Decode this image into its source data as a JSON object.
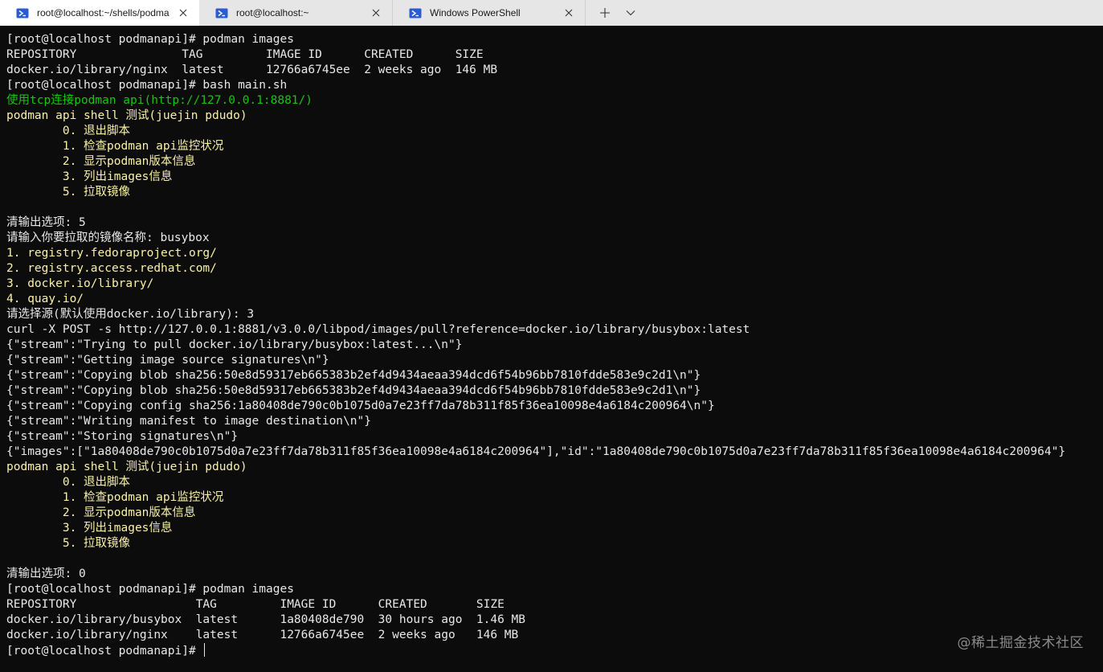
{
  "tabs": [
    {
      "label": "root@localhost:~/shells/podma",
      "icon": "powershell-icon",
      "active": true
    },
    {
      "label": "root@localhost:~",
      "icon": "powershell-icon",
      "active": false
    },
    {
      "label": "Windows PowerShell",
      "icon": "powershell-icon",
      "active": false
    }
  ],
  "tabbar": {
    "new_tab_icon": "plus-icon",
    "dropdown_icon": "chevron-down-icon"
  },
  "colors": {
    "background": "#0c0c0c",
    "foreground": "#e8e8e8",
    "yellow": "#f9f1a5",
    "green": "#16c60c",
    "tabbar": "#e6e6e6",
    "active_tab": "#ffffff",
    "tab_icon": "#2a5bd7"
  },
  "terminal": {
    "lines": [
      {
        "text": "[root@localhost podmanapi]# podman images",
        "color": "white"
      },
      {
        "text": "REPOSITORY               TAG         IMAGE ID      CREATED      SIZE",
        "color": "white"
      },
      {
        "text": "docker.io/library/nginx  latest      12766a6745ee  2 weeks ago  146 MB",
        "color": "white"
      },
      {
        "text": "[root@localhost podmanapi]# bash main.sh",
        "color": "white"
      },
      {
        "text": "使用tcp连接podman api(http://127.0.0.1:8881/)",
        "color": "green"
      },
      {
        "text": "podman api shell 测试(juejin pdudo)",
        "color": "yellow"
      },
      {
        "text": "        0. 退出脚本",
        "color": "yellow"
      },
      {
        "text": "        1. 检查podman api监控状况",
        "color": "yellow"
      },
      {
        "text": "        2. 显示podman版本信息",
        "color": "yellow"
      },
      {
        "text": "        3. 列出images信息",
        "color": "yellow"
      },
      {
        "text": "        5. 拉取镜像",
        "color": "yellow"
      },
      {
        "text": "",
        "color": "white"
      },
      {
        "text": "清输出选项: 5",
        "color": "white"
      },
      {
        "text": "请输入你要拉取的镜像名称: busybox",
        "color": "white"
      },
      {
        "text": "1. registry.fedoraproject.org/",
        "color": "yellow"
      },
      {
        "text": "2. registry.access.redhat.com/",
        "color": "yellow"
      },
      {
        "text": "3. docker.io/library/",
        "color": "yellow"
      },
      {
        "text": "4. quay.io/",
        "color": "yellow"
      },
      {
        "text": "请选择源(默认使用docker.io/library): 3",
        "color": "white"
      },
      {
        "text": "curl -X POST -s http://127.0.0.1:8881/v3.0.0/libpod/images/pull?reference=docker.io/library/busybox:latest",
        "color": "white"
      },
      {
        "text": "{\"stream\":\"Trying to pull docker.io/library/busybox:latest...\\n\"}",
        "color": "white"
      },
      {
        "text": "{\"stream\":\"Getting image source signatures\\n\"}",
        "color": "white"
      },
      {
        "text": "{\"stream\":\"Copying blob sha256:50e8d59317eb665383b2ef4d9434aeaa394dcd6f54b96bb7810fdde583e9c2d1\\n\"}",
        "color": "white"
      },
      {
        "text": "{\"stream\":\"Copying blob sha256:50e8d59317eb665383b2ef4d9434aeaa394dcd6f54b96bb7810fdde583e9c2d1\\n\"}",
        "color": "white"
      },
      {
        "text": "{\"stream\":\"Copying config sha256:1a80408de790c0b1075d0a7e23ff7da78b311f85f36ea10098e4a6184c200964\\n\"}",
        "color": "white"
      },
      {
        "text": "{\"stream\":\"Writing manifest to image destination\\n\"}",
        "color": "white"
      },
      {
        "text": "{\"stream\":\"Storing signatures\\n\"}",
        "color": "white"
      },
      {
        "text": "{\"images\":[\"1a80408de790c0b1075d0a7e23ff7da78b311f85f36ea10098e4a6184c200964\"],\"id\":\"1a80408de790c0b1075d0a7e23ff7da78b311f85f36ea10098e4a6184c200964\"}",
        "color": "white"
      },
      {
        "text": "podman api shell 测试(juejin pdudo)",
        "color": "yellow"
      },
      {
        "text": "        0. 退出脚本",
        "color": "yellow"
      },
      {
        "text": "        1. 检查podman api监控状况",
        "color": "yellow"
      },
      {
        "text": "        2. 显示podman版本信息",
        "color": "yellow"
      },
      {
        "text": "        3. 列出images信息",
        "color": "yellow"
      },
      {
        "text": "        5. 拉取镜像",
        "color": "yellow"
      },
      {
        "text": "",
        "color": "white"
      },
      {
        "text": "清输出选项: 0",
        "color": "white"
      },
      {
        "text": "[root@localhost podmanapi]# podman images",
        "color": "white"
      },
      {
        "text": "REPOSITORY                 TAG         IMAGE ID      CREATED       SIZE",
        "color": "white"
      },
      {
        "text": "docker.io/library/busybox  latest      1a80408de790  30 hours ago  1.46 MB",
        "color": "white"
      },
      {
        "text": "docker.io/library/nginx    latest      12766a6745ee  2 weeks ago   146 MB",
        "color": "white"
      }
    ],
    "prompt": "[root@localhost podmanapi]# "
  },
  "watermark": "@稀土掘金技术社区"
}
